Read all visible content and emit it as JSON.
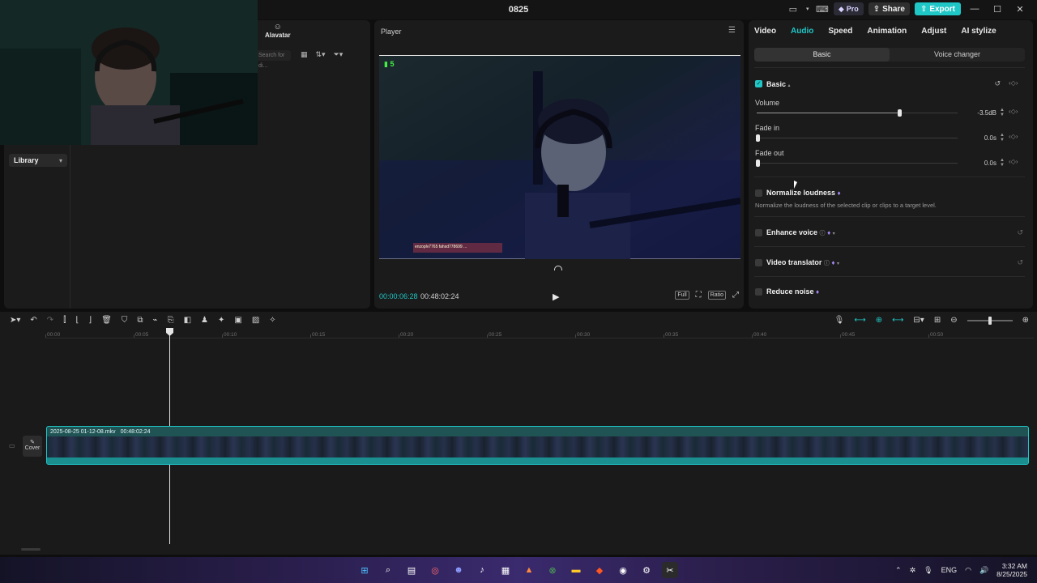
{
  "app": {
    "title": "0825"
  },
  "titlebar": {
    "pro_label": "Pro",
    "share_label": "Share",
    "export_label": "Export"
  },
  "left_panel": {
    "alavatar_label": "Alavatar",
    "library_label": "Library",
    "search_placeholder": "Search for di..."
  },
  "player": {
    "title": "Player",
    "overlay_counter": "5",
    "current_time": "00:00:06:28",
    "total_time": "00:48:02:24",
    "full_label": "Full",
    "ratio_label": "Ratio",
    "chat_overlay_text": "enzoplv7765  fahsd778699  ..."
  },
  "inspector": {
    "tabs": [
      "Video",
      "Audio",
      "Speed",
      "Animation",
      "Adjust",
      "AI stylize"
    ],
    "active_tab": "Audio",
    "subtabs": [
      "Basic",
      "Voice changer"
    ],
    "basic_section": {
      "title": "Basic",
      "volume_label": "Volume",
      "volume_value": "-3.5dB",
      "volume_level": 0.71,
      "fade_in_label": "Fade in",
      "fade_in_value": "0.0s",
      "fade_out_label": "Fade out",
      "fade_out_value": "0.0s"
    },
    "normalize": {
      "title": "Normalize loudness",
      "desc": "Normalize the loudness of the selected clip or clips to a target level."
    },
    "enhance_voice": {
      "title": "Enhance voice"
    },
    "video_translator": {
      "title": "Video translator"
    },
    "reduce_noise": {
      "title": "Reduce noise"
    }
  },
  "timeline": {
    "ruler_ticks": [
      "00:00",
      "00:05",
      "00:10",
      "00:15",
      "00:20",
      "00:25",
      "00:30",
      "00:35",
      "00:40",
      "00:45",
      "00:50"
    ],
    "cover_label": "Cover",
    "clip_name": "2025-08-25 01-12-08.mkv",
    "clip_duration": "00:48:02:24"
  },
  "taskbar": {
    "lang": "ENG",
    "time": "3:32 AM",
    "date": "8/25/2025"
  },
  "colors": {
    "accent": "#20c7c7",
    "panel": "#1b1b1b",
    "premium": "#a78bfa"
  }
}
